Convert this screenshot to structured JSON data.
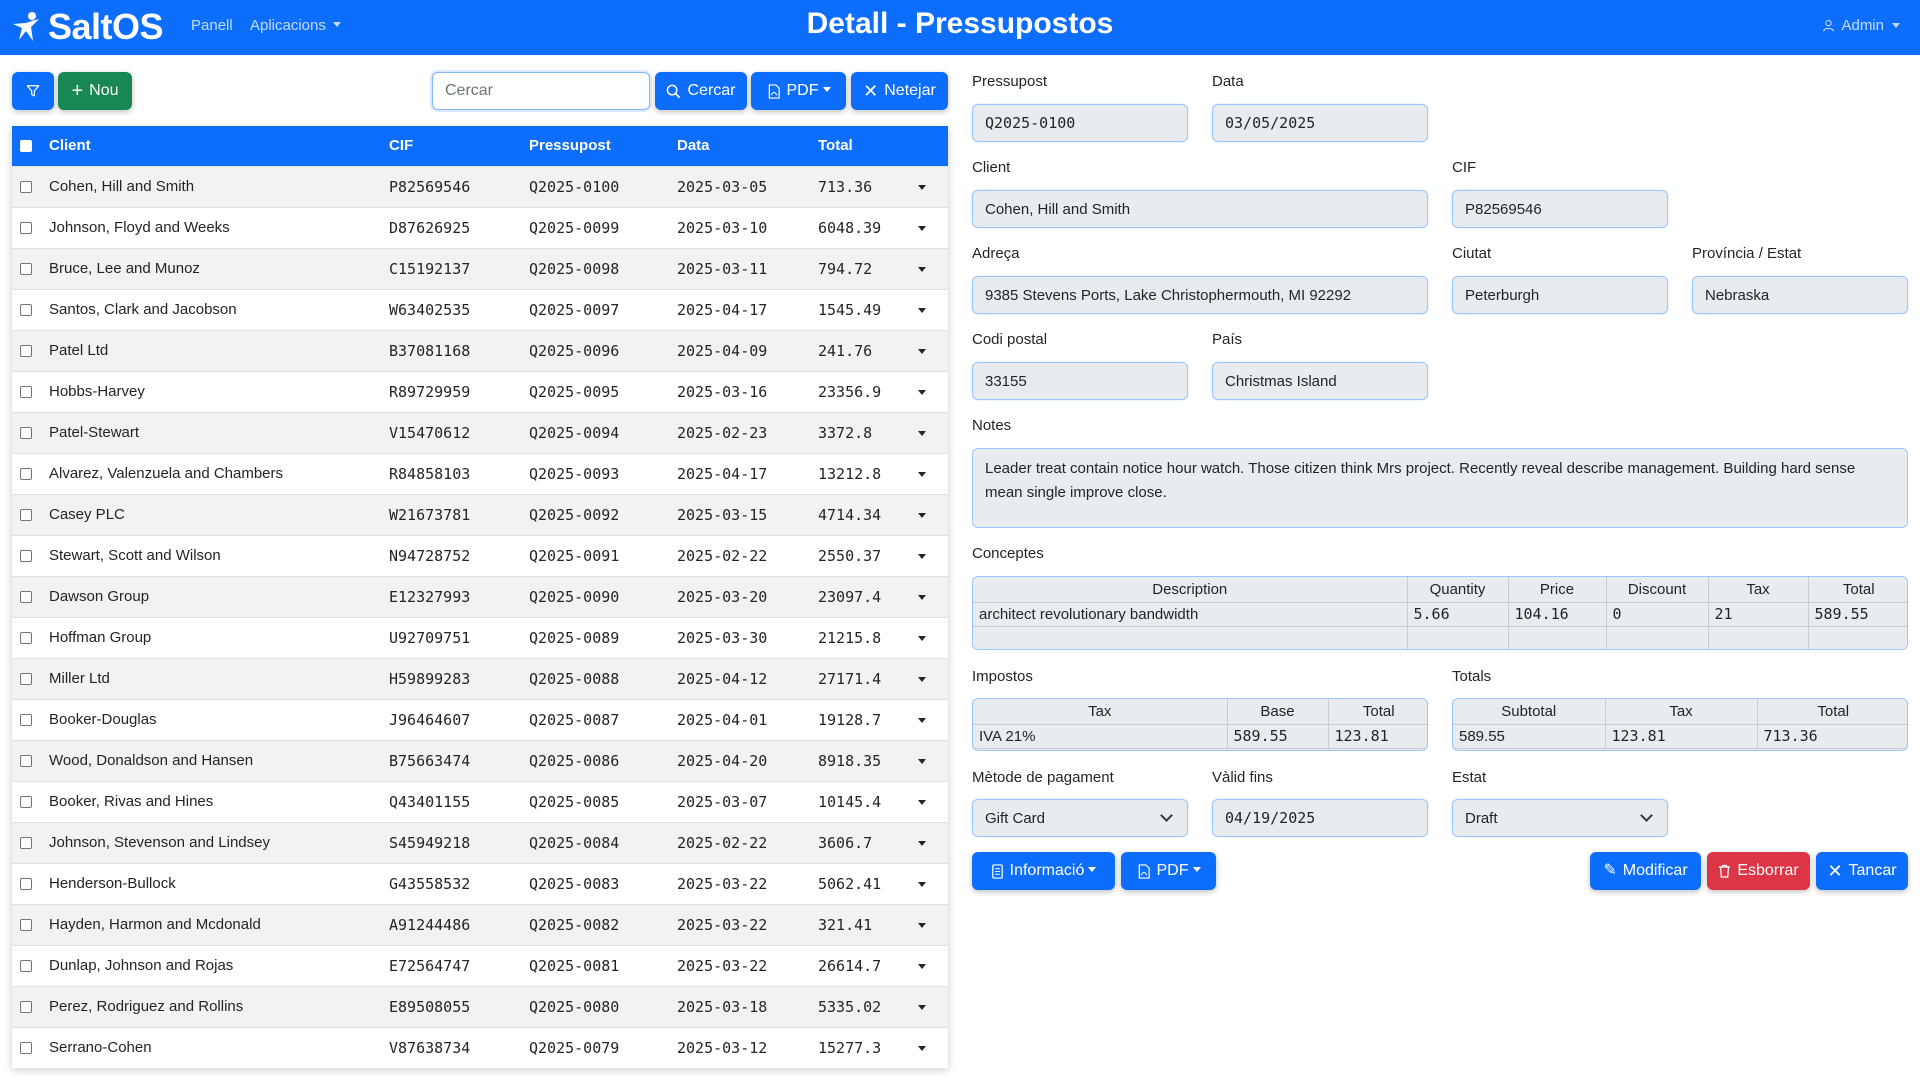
{
  "navbar": {
    "brand": "SaltOS",
    "links": [
      {
        "label": "Panell"
      },
      {
        "label": "Aplicacions"
      }
    ],
    "title": "Detall - Pressupostos",
    "user": "Admin"
  },
  "toolbar": {
    "filter_icon": "filter-icon",
    "new_label": "Nou",
    "search_placeholder": "Cercar",
    "search_label": "Cercar",
    "pdf_label": "PDF",
    "clear_label": "Netejar"
  },
  "list": {
    "headers": [
      "Client",
      "CIF",
      "Pressupost",
      "Data",
      "Total"
    ],
    "rows": [
      {
        "client": "Cohen, Hill and Smith",
        "cif": "P82569546",
        "pressupost": "Q2025-0100",
        "data": "2025-03-05",
        "total": "713.36"
      },
      {
        "client": "Johnson, Floyd and Weeks",
        "cif": "D87626925",
        "pressupost": "Q2025-0099",
        "data": "2025-03-10",
        "total": "6048.39"
      },
      {
        "client": "Bruce, Lee and Munoz",
        "cif": "C15192137",
        "pressupost": "Q2025-0098",
        "data": "2025-03-11",
        "total": "794.72"
      },
      {
        "client": "Santos, Clark and Jacobson",
        "cif": "W63402535",
        "pressupost": "Q2025-0097",
        "data": "2025-04-17",
        "total": "1545.49"
      },
      {
        "client": "Patel Ltd",
        "cif": "B37081168",
        "pressupost": "Q2025-0096",
        "data": "2025-04-09",
        "total": "241.76"
      },
      {
        "client": "Hobbs-Harvey",
        "cif": "R89729959",
        "pressupost": "Q2025-0095",
        "data": "2025-03-16",
        "total": "23356.9"
      },
      {
        "client": "Patel-Stewart",
        "cif": "V15470612",
        "pressupost": "Q2025-0094",
        "data": "2025-02-23",
        "total": "3372.8"
      },
      {
        "client": "Alvarez, Valenzuela and Chambers",
        "cif": "R84858103",
        "pressupost": "Q2025-0093",
        "data": "2025-04-17",
        "total": "13212.8"
      },
      {
        "client": "Casey PLC",
        "cif": "W21673781",
        "pressupost": "Q2025-0092",
        "data": "2025-03-15",
        "total": "4714.34"
      },
      {
        "client": "Stewart, Scott and Wilson",
        "cif": "N94728752",
        "pressupost": "Q2025-0091",
        "data": "2025-02-22",
        "total": "2550.37"
      },
      {
        "client": "Dawson Group",
        "cif": "E12327993",
        "pressupost": "Q2025-0090",
        "data": "2025-03-20",
        "total": "23097.4"
      },
      {
        "client": "Hoffman Group",
        "cif": "U92709751",
        "pressupost": "Q2025-0089",
        "data": "2025-03-30",
        "total": "21215.8"
      },
      {
        "client": "Miller Ltd",
        "cif": "H59899283",
        "pressupost": "Q2025-0088",
        "data": "2025-04-12",
        "total": "27171.4"
      },
      {
        "client": "Booker-Douglas",
        "cif": "J96464607",
        "pressupost": "Q2025-0087",
        "data": "2025-04-01",
        "total": "19128.7"
      },
      {
        "client": "Wood, Donaldson and Hansen",
        "cif": "B75663474",
        "pressupost": "Q2025-0086",
        "data": "2025-04-20",
        "total": "8918.35"
      },
      {
        "client": "Booker, Rivas and Hines",
        "cif": "Q43401155",
        "pressupost": "Q2025-0085",
        "data": "2025-03-07",
        "total": "10145.4"
      },
      {
        "client": "Johnson, Stevenson and Lindsey",
        "cif": "S45949218",
        "pressupost": "Q2025-0084",
        "data": "2025-02-22",
        "total": "3606.7"
      },
      {
        "client": "Henderson-Bullock",
        "cif": "G43558532",
        "pressupost": "Q2025-0083",
        "data": "2025-03-22",
        "total": "5062.41"
      },
      {
        "client": "Hayden, Harmon and Mcdonald",
        "cif": "A91244486",
        "pressupost": "Q2025-0082",
        "data": "2025-03-22",
        "total": "321.41"
      },
      {
        "client": "Dunlap, Johnson and Rojas",
        "cif": "E72564747",
        "pressupost": "Q2025-0081",
        "data": "2025-03-22",
        "total": "26614.7"
      },
      {
        "client": "Perez, Rodriguez and Rollins",
        "cif": "E89508055",
        "pressupost": "Q2025-0080",
        "data": "2025-03-18",
        "total": "5335.02"
      },
      {
        "client": "Serrano-Cohen",
        "cif": "V87638734",
        "pressupost": "Q2025-0079",
        "data": "2025-03-12",
        "total": "15277.3"
      }
    ]
  },
  "form": {
    "labels": {
      "pressupost": "Pressupost",
      "data": "Data",
      "client": "Client",
      "cif": "CIF",
      "adreca": "Adreça",
      "ciutat": "Ciutat",
      "provincia": "Província / Estat",
      "codi_postal": "Codi postal",
      "pais": "País",
      "notes": "Notes",
      "conceptes": "Conceptes",
      "impostos": "Impostos",
      "totals": "Totals",
      "metode": "Mètode de pagament",
      "valid": "Vàlid fins",
      "estat": "Estat"
    },
    "values": {
      "pressupost": "Q2025-0100",
      "data": "03/05/2025",
      "client": "Cohen, Hill and Smith",
      "cif": "P82569546",
      "adreca": "9385 Stevens Ports, Lake Christophermouth, MI 92292",
      "ciutat": "Peterburgh",
      "provincia": "Nebraska",
      "codi_postal": "33155",
      "pais": "Christmas Island",
      "notes": "Leader treat contain notice hour watch. Those citizen think Mrs project. Recently reveal describe management. Building hard sense mean single improve close.",
      "metode": "Gift Card",
      "valid": "04/19/2025",
      "estat": "Draft"
    },
    "conceptes": {
      "headers": [
        "Description",
        "Quantity",
        "Price",
        "Discount",
        "Tax",
        "Total"
      ],
      "rows": [
        [
          "architect revolutionary bandwidth",
          "5.66",
          "104.16",
          "0",
          "21",
          "589.55"
        ]
      ]
    },
    "impostos": {
      "headers": [
        "Tax",
        "Base",
        "Total"
      ],
      "rows": [
        [
          "IVA 21%",
          "589.55",
          "123.81"
        ]
      ]
    },
    "totals": {
      "headers": [
        "Subtotal",
        "Tax",
        "Total"
      ],
      "rows": [
        [
          "589.55",
          "123.81",
          "713.36"
        ]
      ]
    }
  },
  "actions": {
    "informacio": "Informació",
    "pdf": "PDF",
    "modificar": "Modificar",
    "esborrar": "Esborrar",
    "tancar": "Tancar"
  }
}
